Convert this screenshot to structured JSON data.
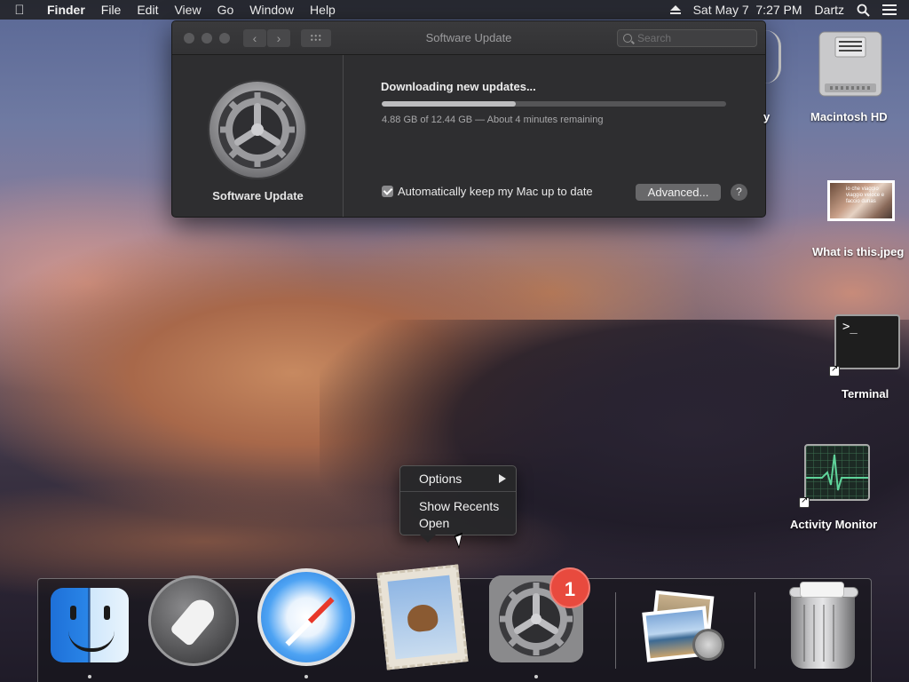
{
  "menubar": {
    "app_name": "Finder",
    "menus": [
      "File",
      "Edit",
      "View",
      "Go",
      "Window",
      "Help"
    ],
    "date_time": "Sat May 7  7:27 PM",
    "user": "Dartz"
  },
  "window": {
    "title": "Software Update",
    "search_placeholder": "Search",
    "sidebar_label": "Software Update",
    "status_title": "Downloading new updates...",
    "progress_fraction": 0.39,
    "progress_text": "4.88 GB of 12.44 GB — About 4 minutes remaining",
    "auto_update_label": "Automatically keep my Mac up to date",
    "auto_update_checked": true,
    "advanced_button": "Advanced...",
    "help_button": "?"
  },
  "desktop_icons": {
    "hd_label": "Macintosh HD",
    "partial_label": "y",
    "image_label": "What is this.jpeg",
    "image_thumb_text": "io che viaggio viaggio veloce e faccio dunas",
    "terminal_label": "Terminal",
    "terminal_prompt": ">_",
    "activity_label": "Activity Monitor"
  },
  "context_menu": {
    "items": [
      "Options",
      "Show Recents",
      "Open"
    ]
  },
  "dock": {
    "apps": [
      "Finder",
      "Launchpad",
      "Safari",
      "Mail",
      "System Preferences",
      "Preview",
      "Trash"
    ],
    "sysprefs_badge": "1"
  },
  "colors": {
    "badge": "#e84a3e",
    "window_bg": "#2e2e30",
    "accent_progress": "#bdbdbf"
  }
}
